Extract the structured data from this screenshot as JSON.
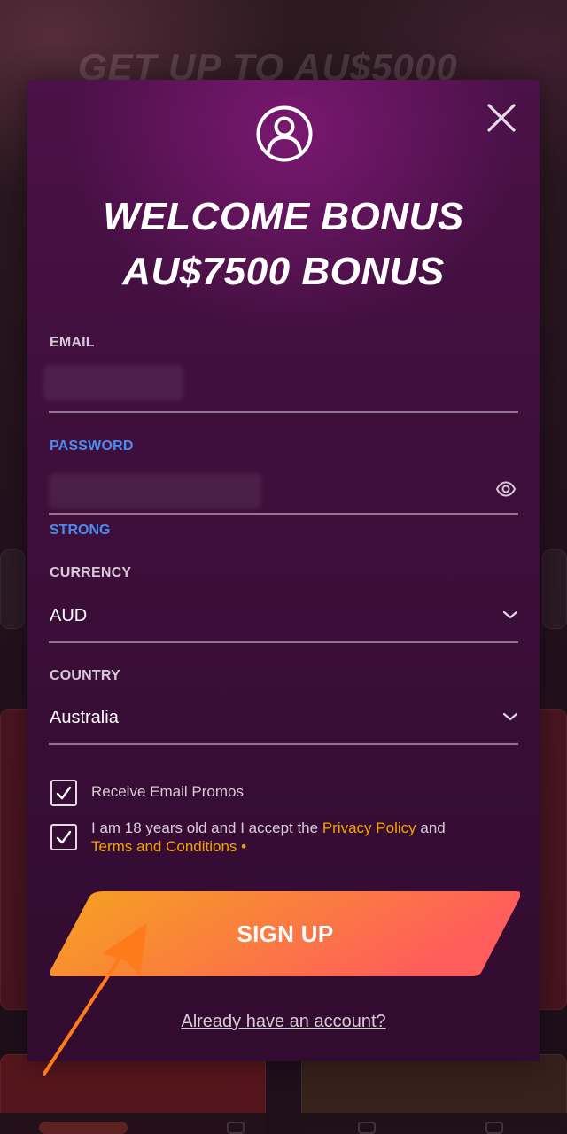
{
  "background": {
    "headline": "GET UP TO AU$5000"
  },
  "modal": {
    "title_line1": "WELCOME BONUS",
    "title_line2": "AU$7500 BONUS",
    "email": {
      "label": "EMAIL",
      "value": ""
    },
    "password": {
      "label": "PASSWORD",
      "value": "",
      "strength": "STRONG"
    },
    "currency": {
      "label": "CURRENCY",
      "value": "AUD"
    },
    "country": {
      "label": "COUNTRY",
      "value": "Australia"
    },
    "promos_checkbox": {
      "label": "Receive Email Promos",
      "checked": true
    },
    "terms_checkbox": {
      "text_before": "I am 18 years old and I accept the ",
      "privacy_link": "Privacy Policy",
      "and": " and",
      "terms_link": "Terms and Conditions",
      "required_mark": " •",
      "checked": true
    },
    "signup_label": "SIGN UP",
    "login_link": "Already have an account?"
  },
  "colors": {
    "accent_link": "#f2a300",
    "focus_blue": "#4a8df0",
    "button_gradient_start": "#f5a31e",
    "button_gradient_end": "#ff5c5c",
    "annotation_arrow": "#ff7a1a"
  },
  "icons": {
    "user": "user-circle-icon",
    "close": "close-icon",
    "eye": "eye-icon",
    "chevron": "chevron-down-icon",
    "check": "check-icon",
    "arrow": "pointer-arrow-icon"
  }
}
